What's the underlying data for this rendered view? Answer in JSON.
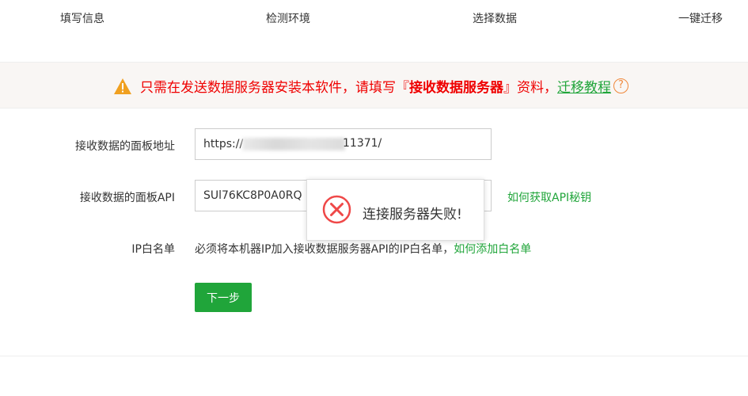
{
  "steps": [
    "填写信息",
    "检测环境",
    "选择数据",
    "一键迁移"
  ],
  "notice": {
    "icon": "warning-icon",
    "text_before": "只需在发送数据服务器安装本软件，请填写『 ",
    "strong": "接收数据服务器",
    "text_after": " 』资料，",
    "link": "迁移教程",
    "help_icon": "?"
  },
  "form": {
    "panel_url_label": "接收数据的面板地址",
    "panel_url_prefix": "https://",
    "panel_url_suffix": "11371/",
    "panel_api_label": "接收数据的面板API",
    "panel_api_value": "SUl76KC8P0A0RQ",
    "api_help_link": "如何获取API秘钥",
    "ip_whitelist_label": "IP白名单",
    "ip_whitelist_text": "必须将本机器IP加入接收数据服务器API的IP白名单，",
    "ip_whitelist_link": "如何添加白名单",
    "next_button": "下一步"
  },
  "toast": {
    "icon": "error-circle-icon",
    "message": "连接服务器失败!"
  },
  "colors": {
    "accent": "#20a53a",
    "warning": "#ef0000",
    "error_icon": "#ef4848",
    "help": "#f0883b"
  }
}
